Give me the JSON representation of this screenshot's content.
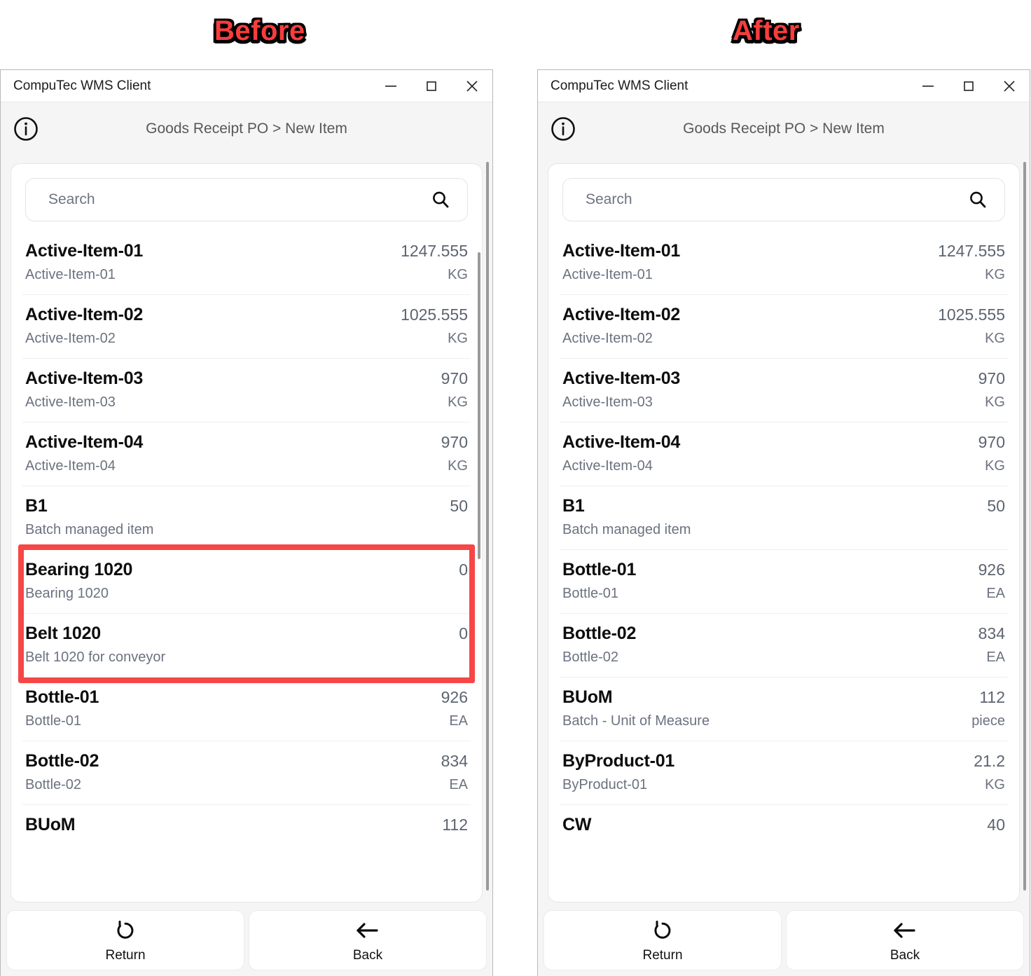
{
  "annotations": {
    "before": "Before",
    "after": "After"
  },
  "colors": {
    "annotation_text": "#f73d3d",
    "annotation_outline": "#000000",
    "highlight_border": "#f64646",
    "item_code": "#0d0d0d",
    "item_muted": "#6b7280",
    "titlebar_bg": "#ffffff",
    "panel_bg": "#f5f5f5"
  },
  "window": {
    "app_title": "CompuTec WMS Client",
    "controls": {
      "minimize": "minimize-icon",
      "maximize": "maximize-icon",
      "close": "close-icon"
    },
    "info_icon": "info-icon",
    "breadcrumb": "Goods Receipt PO > New Item"
  },
  "search": {
    "placeholder": "Search",
    "value": "",
    "icon": "search-icon"
  },
  "footer": {
    "return": {
      "label": "Return",
      "icon": "undo-icon"
    },
    "back": {
      "label": "Back",
      "icon": "arrow-left-icon"
    }
  },
  "before": {
    "items": [
      {
        "code": "Active-Item-01",
        "desc": "Active-Item-01",
        "qty": "1247.555",
        "uom": "KG"
      },
      {
        "code": "Active-Item-02",
        "desc": "Active-Item-02",
        "qty": "1025.555",
        "uom": "KG"
      },
      {
        "code": "Active-Item-03",
        "desc": "Active-Item-03",
        "qty": "970",
        "uom": "KG"
      },
      {
        "code": "Active-Item-04",
        "desc": "Active-Item-04",
        "qty": "970",
        "uom": "KG"
      },
      {
        "code": "B1",
        "desc": "Batch managed item",
        "qty": "50",
        "uom": ""
      },
      {
        "code": "Bearing 1020",
        "desc": "Bearing 1020",
        "qty": "0",
        "uom": ""
      },
      {
        "code": "Belt 1020",
        "desc": "Belt 1020 for conveyor",
        "qty": "0",
        "uom": ""
      },
      {
        "code": "Bottle-01",
        "desc": "Bottle-01",
        "qty": "926",
        "uom": "EA"
      },
      {
        "code": "Bottle-02",
        "desc": "Bottle-02",
        "qty": "834",
        "uom": "EA"
      },
      {
        "code": "BUoM",
        "desc": "",
        "qty": "112",
        "uom": ""
      }
    ],
    "highlight_rows": [
      5,
      6
    ]
  },
  "after": {
    "items": [
      {
        "code": "Active-Item-01",
        "desc": "Active-Item-01",
        "qty": "1247.555",
        "uom": "KG"
      },
      {
        "code": "Active-Item-02",
        "desc": "Active-Item-02",
        "qty": "1025.555",
        "uom": "KG"
      },
      {
        "code": "Active-Item-03",
        "desc": "Active-Item-03",
        "qty": "970",
        "uom": "KG"
      },
      {
        "code": "Active-Item-04",
        "desc": "Active-Item-04",
        "qty": "970",
        "uom": "KG"
      },
      {
        "code": "B1",
        "desc": "Batch managed item",
        "qty": "50",
        "uom": ""
      },
      {
        "code": "Bottle-01",
        "desc": "Bottle-01",
        "qty": "926",
        "uom": "EA"
      },
      {
        "code": "Bottle-02",
        "desc": "Bottle-02",
        "qty": "834",
        "uom": "EA"
      },
      {
        "code": "BUoM",
        "desc": "Batch - Unit of Measure",
        "qty": "112",
        "uom": "piece"
      },
      {
        "code": "ByProduct-01",
        "desc": "ByProduct-01",
        "qty": "21.2",
        "uom": "KG"
      },
      {
        "code": "CW",
        "desc": "",
        "qty": "40",
        "uom": ""
      }
    ],
    "highlight_rows": []
  }
}
